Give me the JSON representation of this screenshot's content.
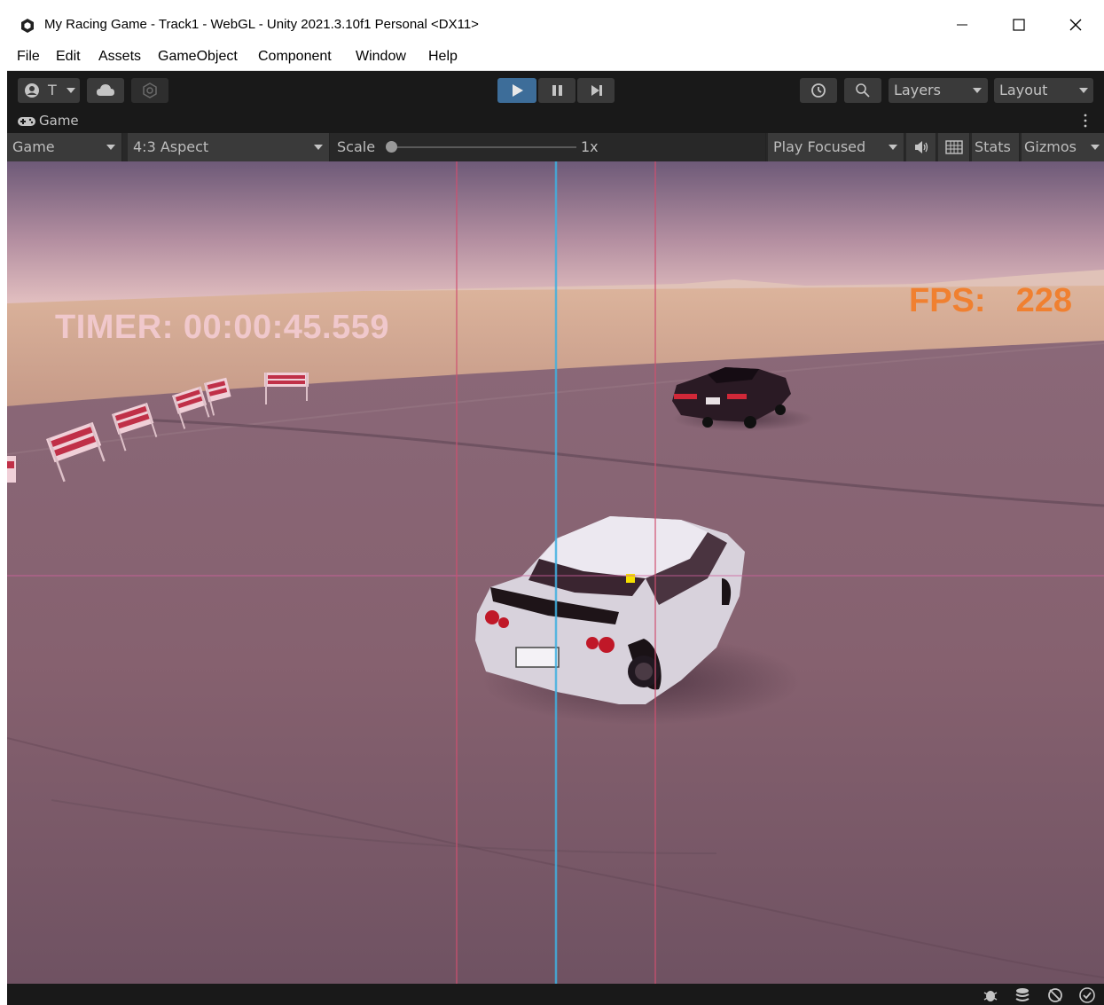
{
  "window": {
    "title": "My Racing Game - Track1 - WebGL - Unity 2021.3.10f1 Personal <DX11>",
    "controls": [
      "minimize",
      "maximize",
      "close"
    ]
  },
  "menu": {
    "items": [
      "File",
      "Edit",
      "Assets",
      "GameObject",
      "Component",
      "Window",
      "Help"
    ]
  },
  "toolbar": {
    "account_label": "T",
    "icons": [
      "account-icon",
      "cloud-icon",
      "collab-icon"
    ],
    "playback": [
      "play-icon",
      "pause-icon",
      "step-icon"
    ],
    "layers_label": "Layers",
    "layout_label": "Layout"
  },
  "tab": {
    "label": "Game"
  },
  "game_toolbar": {
    "display_label": "Game",
    "aspect_label": "4:3 Aspect",
    "scale_label": "Scale",
    "scale_value": "1x",
    "play_mode_label": "Play Focused",
    "stats_label": "Stats",
    "gizmos_label": "Gizmos"
  },
  "hud": {
    "timer_text": "TIMER: 00:00:45.559",
    "fps_label": "FPS:",
    "fps_value": "228"
  },
  "status_icons": [
    "bug-icon",
    "stack-icon",
    "debug-icon",
    "check-icon"
  ],
  "colors": {
    "play_active": "#3d6d99",
    "fps_text": "#f08030",
    "timer_text": "#f0c8cc",
    "guide_red": "#d05070",
    "guide_blue": "#40b0e0"
  }
}
